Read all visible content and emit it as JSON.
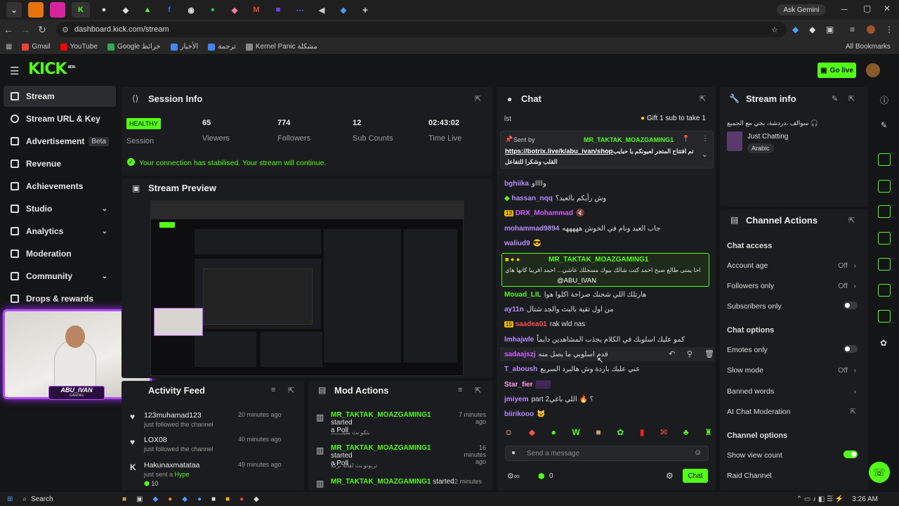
{
  "browser": {
    "url": "dashboard.kick.com/stream",
    "ask_gemini": "Ask Gemini",
    "bookmarks": [
      "Gmail",
      "YouTube",
      "Google خرائط",
      "الأخبار",
      "ترجمة",
      "Kernel Panic مشكلة"
    ],
    "all_bookmarks": "All Bookmarks"
  },
  "header": {
    "logo": "KICK",
    "beta": "BETA",
    "go_live": "Go live"
  },
  "sidebar": {
    "items": [
      {
        "label": "Stream",
        "active": true
      },
      {
        "label": "Stream URL & Key"
      },
      {
        "label": "Advertisement",
        "badge": "Beta"
      },
      {
        "label": "Revenue"
      },
      {
        "label": "Achievements"
      },
      {
        "label": "Studio",
        "chev": "⌄"
      },
      {
        "label": "Analytics",
        "chev": "⌄"
      },
      {
        "label": "Moderation"
      },
      {
        "label": "Community",
        "chev": "⌄"
      },
      {
        "label": "Drops & rewards"
      }
    ]
  },
  "session": {
    "title": "Session Info",
    "health": "HEALTHY",
    "health_lbl": "Session",
    "viewers": "65",
    "viewers_lbl": "Viewers",
    "followers": "774",
    "followers_lbl": "Followers",
    "subs": "12",
    "subs_lbl": "Sub Counts",
    "time": "02:43:02",
    "time_lbl": "Time Live",
    "message": "Your connection has stabilised. Your stream will continue."
  },
  "preview": {
    "title": "Stream Preview",
    "cam_name": "ABU_IVAN",
    "cam_sub": "GAMING"
  },
  "activity": {
    "title": "Activity Feed",
    "items": [
      {
        "user": "123muhamad123",
        "action": "just followed the channel",
        "time": "20 minutes ago"
      },
      {
        "user": "LOX08",
        "action": "just followed the channel",
        "time": "40 minutes ago"
      },
      {
        "user": "Hakunaxmatataa",
        "action": "just sent a",
        "hype": "Hype",
        "count": "10",
        "time": "49 minutes ago"
      }
    ]
  },
  "mod": {
    "title": "Mod Actions",
    "items": [
      {
        "user": "MR_TAKTAK_MOAZGAMING1",
        "action": "started",
        "what": "a Poll",
        "detail": "بنكو بث سيئـــــــ",
        "time": "7 minutes ago"
      },
      {
        "user": "MR_TAKTAK_MOAZGAMING1",
        "action": "started",
        "what": "a Poll",
        "detail": "تربونو بث لقائه تركه",
        "time": "16 minutes ago"
      },
      {
        "user": "MR_TAKTAK_MOAZGAMING1",
        "action": "started",
        "time": "22 minutes"
      }
    ]
  },
  "chat": {
    "title": "Chat",
    "top_user": "lst",
    "gift": "Gift 1 sub to take 1",
    "pinned_by": "Sent by",
    "pinned_user": "MR_TAKTAK_MOAZGAMING1",
    "pinned_link": "https://botrix.live/k/abu_ivan/shop",
    "pinned_text": "تم افتتاح المتجر لعيونكم يا حبايب",
    "pinned_text2": "القلب وشكرا للتفاعل",
    "messages": [
      {
        "user": "bghiika",
        "color": "#b48cff",
        "text": "وااااو"
      },
      {
        "user": "hassan_nqq",
        "color": "#b48cff",
        "text": "وش رأيكم بالعيد؟"
      },
      {
        "user": "DRX_Mohammad",
        "color": "#d55cff",
        "text": "🔇",
        "badge": "13"
      },
      {
        "user": "mohammad9894",
        "color": "#b48cff",
        "text": "جاب العيد ونام في الحوش هههههه"
      },
      {
        "user": "waliud9",
        "color": "#b48cff",
        "text": "😎"
      },
      {
        "user": "Mouad_LIL",
        "color": "#53fc18",
        "text": "هارتلك اللي شحنك صراحة اكلوا هوا"
      },
      {
        "user": "ay11n",
        "color": "#b48cff",
        "text": "من اول تقية بالبث والجد شتال"
      },
      {
        "user": "saadea01",
        "color": "#ff4d4d",
        "text": "rak wld nas",
        "badge": "15"
      },
      {
        "user": "lmhajwle",
        "color": "#b48cff",
        "text": "كمو عليك اسلوبك في الكلام يجذب المشاهدين دايماً"
      },
      {
        "user": "sadaajszj",
        "color": "#d55cff",
        "text": "قدم اسلوبي ما يصل منه"
      },
      {
        "user": "T_aboush",
        "color": "#b48cff",
        "text": "عني عليك باردة وش هالبرد السريع"
      },
      {
        "user": "Star_fier",
        "color": "#ff9ef0",
        "text": "▒▒▒"
      },
      {
        "user": "jmiyem",
        "color": "#b48cff",
        "text": "part 2؟ 🔥 اللي باغي"
      },
      {
        "user": "biirikooo",
        "color": "#b48cff",
        "text": "🐱"
      }
    ],
    "highlight_user": "MR_TAKTAK_MOAZGAMING1",
    "highlight_text": "احا يمتى طالع صبح احمد كنت شالك بيوك مسجلك عاشي... احمد اقريبا كانها هاي",
    "highlight_mention": "@ABU_IVAN",
    "placeholder": "Send a message",
    "send": "Chat",
    "count": "0"
  },
  "stream_info": {
    "title": "Stream info",
    "stream_title": "سوالف ،دردشة، يجي مع الجميع 🎧",
    "category": "Just Chatting",
    "tag": "Arabic"
  },
  "channel_actions": {
    "title": "Channel Actions",
    "chat_access": "Chat access",
    "account_age": "Account age",
    "account_age_val": "Off",
    "followers_only": "Followers only",
    "followers_only_val": "Off",
    "subscribers_only": "Subscribers only",
    "chat_options": "Chat options",
    "emotes_only": "Emotes only",
    "slow_mode": "Slow mode",
    "slow_mode_val": "Off",
    "banned_words": "Banned words",
    "ai_mod": "AI Chat Moderation",
    "channel_options": "Channel options",
    "show_view_count": "Show view count",
    "raid": "Raid Channel"
  },
  "taskbar": {
    "search": "Search",
    "time": "3:26 AM"
  },
  "colors": {
    "accent": "#53fc18",
    "panel": "#1b1c1f",
    "bg": "#141517"
  }
}
